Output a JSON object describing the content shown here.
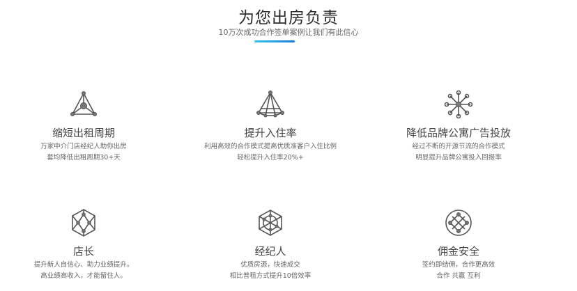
{
  "header": {
    "title": "为您出房负责",
    "subtitle": "10万次成功合作签单案例让我们有此信心",
    "accent_gradient": [
      "#2fc6e8",
      "#1a78e0"
    ]
  },
  "features": [
    {
      "icon": "triangle-network-icon",
      "title": "缩短出租周期",
      "desc": [
        "万家中介门店经纪人助你出房",
        "套均降低出租周期30+天"
      ]
    },
    {
      "icon": "pyramid-network-icon",
      "title": "提升入住率",
      "desc": [
        "利用高效的合作模式提高优质准客户入住比例",
        "轻松提升入住率20%+"
      ]
    },
    {
      "icon": "hub-network-icon",
      "title": "降低品牌公寓广告投放",
      "desc": [
        "经过不断的开源节流的合作模式",
        "明显提升品牌公寓投入回报率"
      ]
    },
    {
      "icon": "hexagon-network-icon",
      "title": "店长",
      "desc": [
        "提升新人自信心、助力业绩提升。",
        "高业绩高收入，才能留住人。"
      ]
    },
    {
      "icon": "hexagon-circle-icon",
      "title": "经纪人",
      "desc": [
        "优质房源，快速成交",
        "相比普租方式提升10倍效率"
      ]
    },
    {
      "icon": "circle-network-icon",
      "title": "佣金安全",
      "desc": [
        "签约即结佣，合作更高效",
        "合作 共赢 互利"
      ]
    }
  ]
}
